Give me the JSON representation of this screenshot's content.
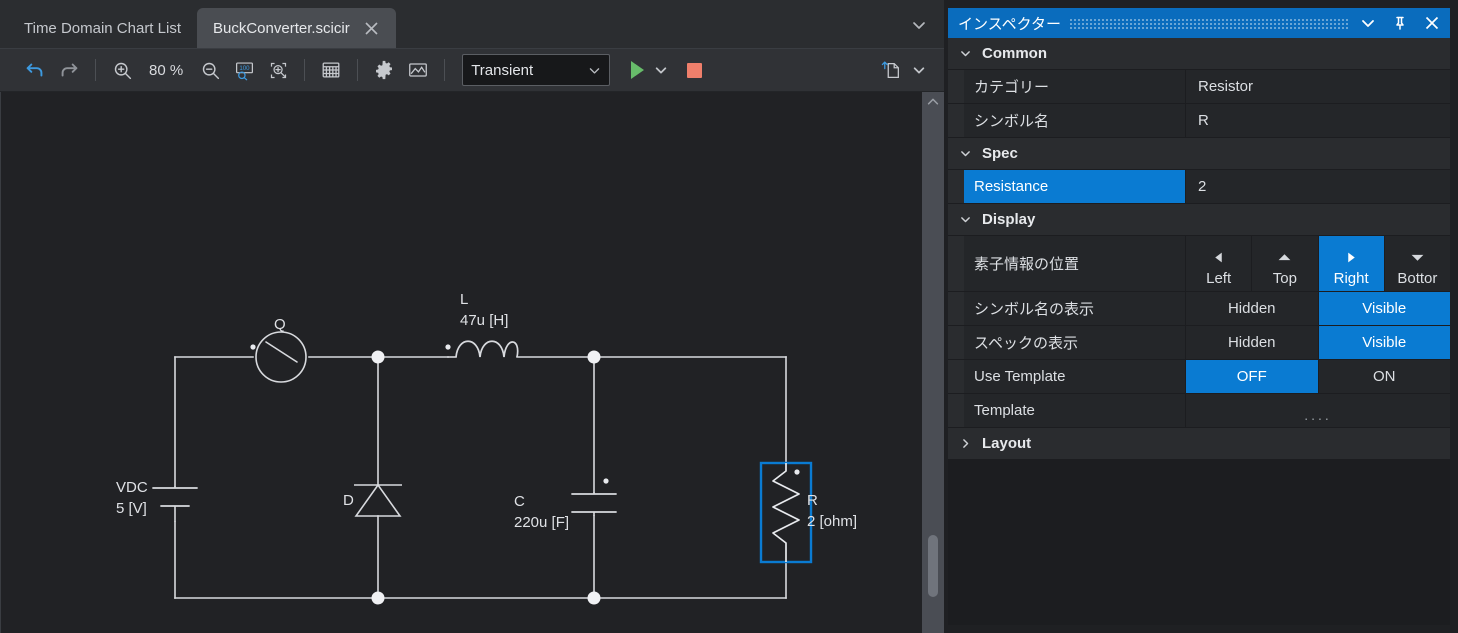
{
  "window": {
    "accent_blue": "#0a7bd2",
    "header_blue": "#0a6cbd"
  },
  "tabs": [
    {
      "label": "Time Domain Chart List",
      "active": false,
      "closable": false
    },
    {
      "label": "BuckConverter.scicir",
      "active": true,
      "closable": true
    }
  ],
  "tabbar": {
    "overflow_icon": "chevron-down-icon"
  },
  "toolbar": {
    "undo_icon": "undo-icon",
    "redo_icon": "redo-icon",
    "zoom_in_icon": "zoom-in-icon",
    "zoom_level": "80 %",
    "zoom_out_icon": "zoom-out-icon",
    "zoom_100_icon": "zoom-100-icon",
    "zoom_fit_icon": "zoom-fit-icon",
    "grid_icon": "grid-icon",
    "settings_icon": "gear-icon",
    "image_icon": "image-icon",
    "sim_mode": "Transient",
    "sim_mode_caret_icon": "chevron-down-icon",
    "run_icon": "play-icon",
    "run_more_icon": "chevron-down-icon",
    "stop_icon": "stop-icon",
    "export_icon": "export-file-icon",
    "export_more_icon": "chevron-down-icon"
  },
  "canvas": {
    "scrollbar": {
      "up_arrow_icon": "chevron-up-icon"
    },
    "components": [
      {
        "id": "VDC",
        "name": "VDC",
        "spec": "5 [V]",
        "type": "voltage-source"
      },
      {
        "id": "Q",
        "name": "Q",
        "spec": "",
        "type": "switch"
      },
      {
        "id": "L",
        "name": "L",
        "spec": "47u [H]",
        "type": "inductor"
      },
      {
        "id": "D",
        "name": "D",
        "spec": "",
        "type": "diode"
      },
      {
        "id": "C",
        "name": "C",
        "spec": "220u [F]",
        "type": "capacitor"
      },
      {
        "id": "R",
        "name": "R",
        "spec": "2 [ohm]",
        "type": "resistor",
        "selected": true
      }
    ]
  },
  "inspector": {
    "title": "インスペクター",
    "collapse_icon": "chevron-down-icon",
    "pin_icon": "pin-icon",
    "close_icon": "close-icon",
    "groups": [
      {
        "name": "Common",
        "expanded": true,
        "rows": [
          {
            "label": "カテゴリー",
            "value": "Resistor",
            "kind": "text"
          },
          {
            "label": "シンボル名",
            "value": "R",
            "kind": "text"
          }
        ]
      },
      {
        "name": "Spec",
        "expanded": true,
        "rows": [
          {
            "label": "Resistance",
            "value": "2",
            "kind": "text",
            "label_selected": true
          }
        ]
      },
      {
        "name": "Display",
        "expanded": true,
        "rows": [
          {
            "label": "素子情報の位置",
            "kind": "segmented-arrows",
            "options": [
              {
                "label": "Left",
                "glyph": "arrow-left-icon",
                "selected": false
              },
              {
                "label": "Top",
                "glyph": "arrow-up-icon",
                "selected": false
              },
              {
                "label": "Right",
                "glyph": "arrow-right-icon",
                "selected": true
              },
              {
                "label": "Bottor",
                "glyph": "arrow-down-icon",
                "selected": false
              }
            ]
          },
          {
            "label": "シンボル名の表示",
            "kind": "segmented",
            "options": [
              {
                "label": "Hidden",
                "selected": false
              },
              {
                "label": "Visible",
                "selected": true
              }
            ]
          },
          {
            "label": "スペックの表示",
            "kind": "segmented",
            "options": [
              {
                "label": "Hidden",
                "selected": false
              },
              {
                "label": "Visible",
                "selected": true
              }
            ]
          },
          {
            "label": "Use Template",
            "kind": "segmented",
            "options": [
              {
                "label": "OFF",
                "selected": true
              },
              {
                "label": "ON",
                "selected": false
              }
            ]
          },
          {
            "label": "Template",
            "value": "....",
            "kind": "ellipsis"
          }
        ]
      },
      {
        "name": "Layout",
        "expanded": false,
        "rows": []
      }
    ]
  }
}
